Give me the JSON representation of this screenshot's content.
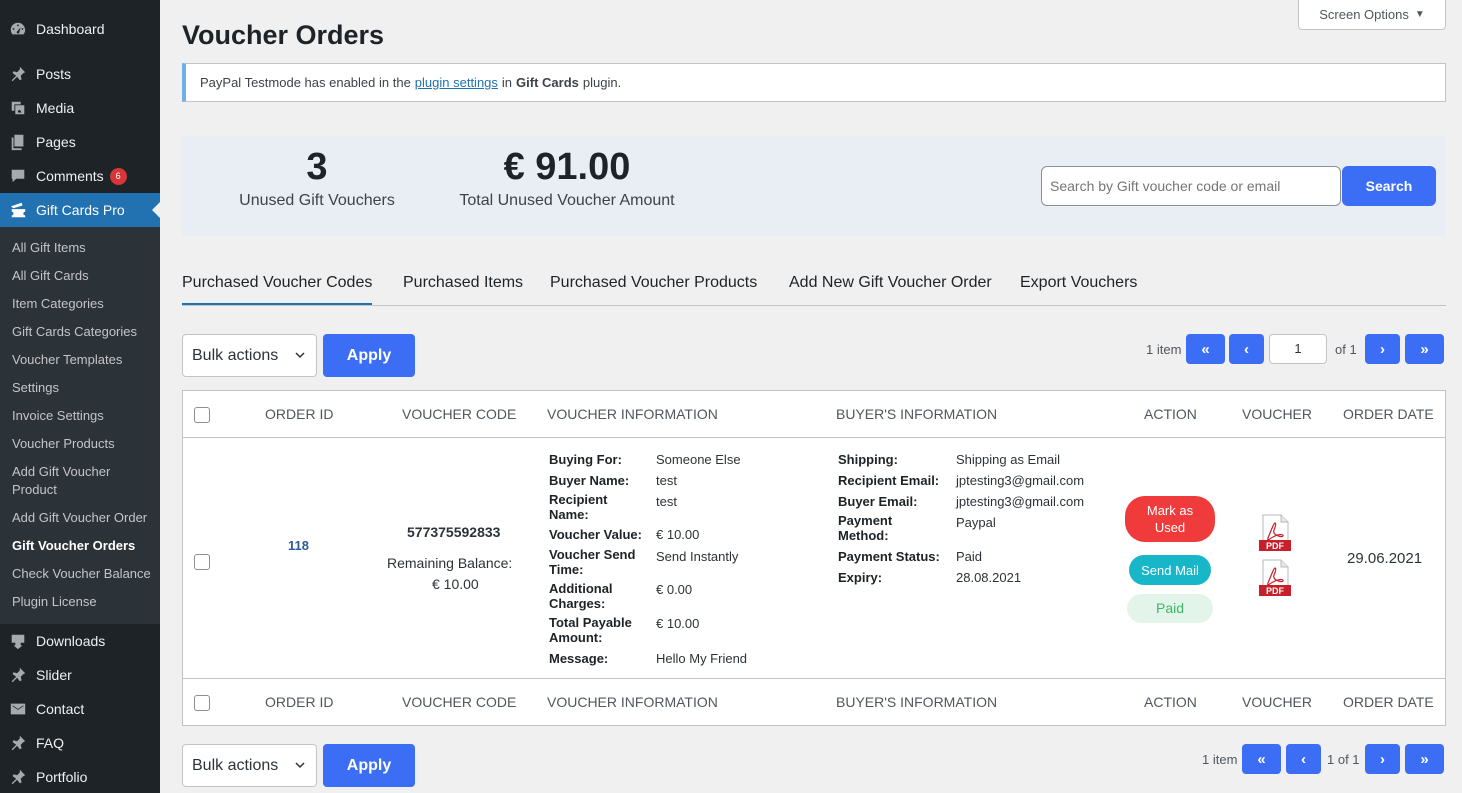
{
  "sidebar": {
    "menu": [
      {
        "label": "Dashboard",
        "icon": "dashboard-icon"
      },
      {
        "label": "Posts",
        "icon": "pin-icon"
      },
      {
        "label": "Media",
        "icon": "media-icon"
      },
      {
        "label": "Pages",
        "icon": "pages-icon"
      },
      {
        "label": "Comments",
        "icon": "comment-icon",
        "badge": "6"
      },
      {
        "label": "Gift Cards Pro",
        "icon": "ticket-icon"
      }
    ],
    "submenu": [
      "All Gift Items",
      "All Gift Cards",
      "Item Categories",
      "Gift Cards Categories",
      "Voucher Templates",
      "Settings",
      "Invoice Settings",
      "Voucher Products",
      "Add Gift Voucher Product",
      "Add Gift Voucher Order",
      "Gift Voucher Orders",
      "Check Voucher Balance",
      "Plugin License"
    ],
    "menu_bottom": [
      {
        "label": "Downloads",
        "icon": "download-icon"
      },
      {
        "label": "Slider",
        "icon": "pin-icon"
      },
      {
        "label": "Contact",
        "icon": "mail-icon"
      },
      {
        "label": "FAQ",
        "icon": "pin-icon"
      },
      {
        "label": "Portfolio",
        "icon": "pin-icon"
      }
    ]
  },
  "header": {
    "title": "Voucher Orders",
    "screen_options": "Screen Options"
  },
  "notice": {
    "text_before": "PayPal Testmode has enabled in the",
    "link": "plugin settings",
    "text_middle": "in",
    "bold": "Gift Cards",
    "text_after": "plugin."
  },
  "stats": {
    "unused_count": "3",
    "unused_count_label": "Unused Gift Vouchers",
    "unused_amount": "€ 91.00",
    "unused_amount_label": "Total Unused Voucher Amount"
  },
  "search": {
    "placeholder": "Search by Gift voucher code or email",
    "button": "Search"
  },
  "tabs": [
    "Purchased Voucher Codes",
    "Purchased Items",
    "Purchased Voucher Products",
    "Add New Gift Voucher Order",
    "Export Vouchers"
  ],
  "bulk": {
    "label": "Bulk actions",
    "apply": "Apply"
  },
  "pager_top": {
    "items": "1 item",
    "first": "«",
    "prev": "‹",
    "page": "1",
    "of": "of 1",
    "next": "›",
    "last": "»"
  },
  "pager_bottom": {
    "items": "1 item",
    "first": "«",
    "prev": "‹",
    "of": "1 of 1",
    "next": "›",
    "last": "»"
  },
  "table": {
    "columns": [
      "ORDER ID",
      "VOUCHER CODE",
      "VOUCHER INFORMATION",
      "BUYER'S INFORMATION",
      "ACTION",
      "VOUCHER",
      "ORDER DATE"
    ],
    "row": {
      "order_id": "118",
      "voucher_code": "577375592833",
      "remaining_label": "Remaining Balance:",
      "remaining_value": "€ 10.00",
      "voucher_info": [
        {
          "label": "Buying For:",
          "value": "Someone Else"
        },
        {
          "label": "Buyer Name:",
          "value": "test"
        },
        {
          "label": "Recipient Name:",
          "value": "test"
        },
        {
          "label": "Voucher Value:",
          "value": "€ 10.00"
        },
        {
          "label": "Voucher Send Time:",
          "value": "Send Instantly"
        },
        {
          "label": "Additional Charges:",
          "value": "€ 0.00"
        },
        {
          "label": "Total Payable Amount:",
          "value": "€ 10.00"
        },
        {
          "label": "Message:",
          "value": "Hello My Friend"
        }
      ],
      "buyer_info": [
        {
          "label": "Shipping:",
          "value": "Shipping as Email"
        },
        {
          "label": "Recipient Email:",
          "value": "jptesting3@gmail.com"
        },
        {
          "label": "Buyer Email:",
          "value": "jptesting3@gmail.com"
        },
        {
          "label": "Payment Method:",
          "value": "Paypal"
        },
        {
          "label": "Payment Status:",
          "value": "Paid"
        },
        {
          "label": "Expiry:",
          "value": "28.08.2021"
        }
      ],
      "actions": {
        "mark_used": "Mark as Used",
        "send_mail": "Send Mail",
        "paid": "Paid"
      },
      "pdf_label": "PDF",
      "order_date": "29.06.2021"
    }
  },
  "colors": {
    "sidebar_bg": "#1d2327",
    "submenu_bg": "#2c3338",
    "active_menu": "#2271b1",
    "primary_button": "#3b6ef5",
    "mark_used_red": "#ef3b3b",
    "send_mail_teal": "#17b6c9",
    "paid_green_bg": "#e3f5ea",
    "paid_green_text": "#3cb863",
    "pdf_red": "#c8202a"
  }
}
